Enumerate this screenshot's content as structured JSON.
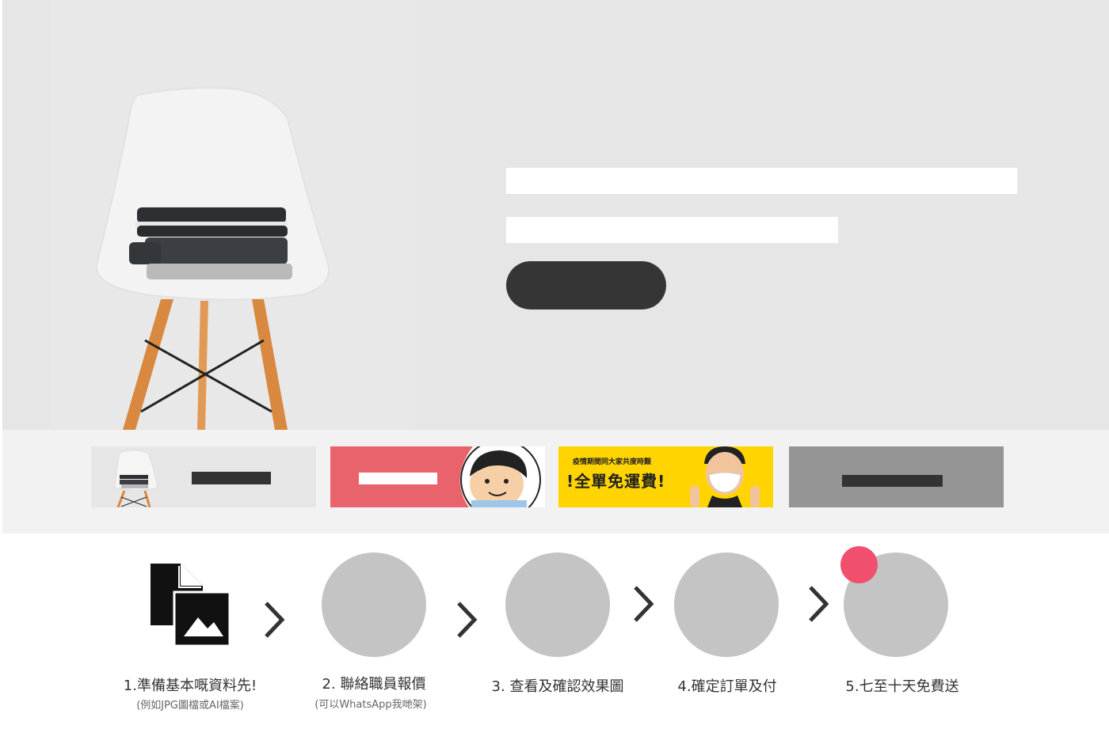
{
  "hero": {
    "title_bar": "",
    "subtitle_bar": "",
    "cta_label": ""
  },
  "banners": [
    {
      "name": "chair-banner",
      "text": ""
    },
    {
      "name": "cartoon-banner",
      "text": ""
    },
    {
      "name": "free-shipping-banner",
      "top_text": "疫情期間同大家共度時艱",
      "main_text": "!全單免運費!"
    },
    {
      "name": "grey-banner",
      "text": ""
    }
  ],
  "steps": [
    {
      "label": "1.準備基本嘅資料先!",
      "sub": "(例如JPG圖檔或AI檔案)",
      "icon": "file-image-icon"
    },
    {
      "label": "2. 聯絡職員報價",
      "sub": "(可以WhatsApp我哋架)",
      "icon": "placeholder-circle"
    },
    {
      "label": "3. 查看及確認效果圖",
      "sub": "",
      "icon": "placeholder-circle"
    },
    {
      "label": "4.確定訂單及付",
      "sub": "",
      "icon": "placeholder-circle"
    },
    {
      "label": "5.七至十天免費送",
      "sub": "",
      "icon": "placeholder-circle"
    }
  ],
  "colors": {
    "hero_bg": "#e6e6e6",
    "strip_bg": "#f2f2f2",
    "cta": "#353535",
    "placeholder": "#c4c4c4",
    "notification_dot": "#f0506e",
    "banner_yellow": "#ffd400",
    "banner_red": "#e8636b",
    "banner_grey": "#959595"
  }
}
